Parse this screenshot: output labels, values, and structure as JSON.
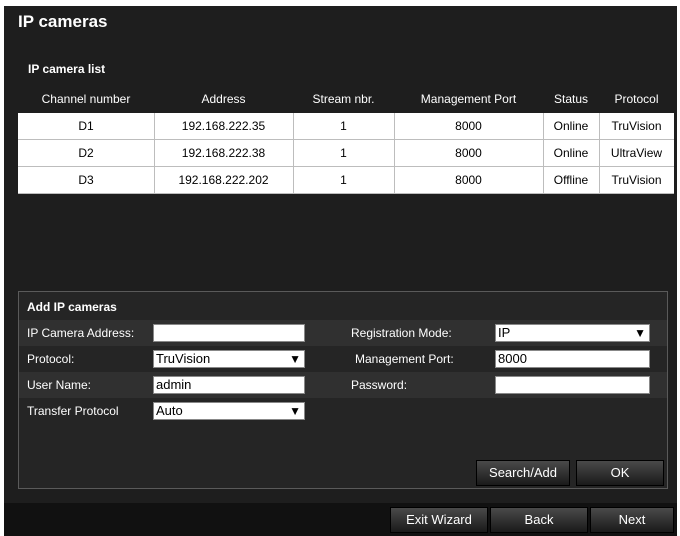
{
  "window": {
    "title": "IP cameras"
  },
  "list": {
    "label": "IP camera list",
    "headers": [
      "Channel number",
      "Address",
      "Stream nbr.",
      "Management Port",
      "Status",
      "Protocol"
    ],
    "rows": [
      [
        "D1",
        "192.168.222.35",
        "1",
        "8000",
        "Online",
        "TruVision"
      ],
      [
        "D2",
        "192.168.222.38",
        "1",
        "8000",
        "Online",
        "UltraView"
      ],
      [
        "D3",
        "192.168.222.202",
        "1",
        "8000",
        "Offline",
        "TruVision"
      ]
    ]
  },
  "add": {
    "title": "Add IP cameras",
    "ip_label": "IP Camera Address:",
    "ip_value": "",
    "reg_mode_label": "Registration Mode:",
    "reg_mode_value": "IP",
    "protocol_label": "Protocol:",
    "protocol_value": "TruVision",
    "mgmt_port_label": "Management Port:",
    "mgmt_port_value": "8000",
    "user_label": "User Name:",
    "user_value": "admin",
    "password_label": "Password:",
    "password_value": "",
    "transfer_label": "Transfer Protocol",
    "transfer_value": "Auto",
    "search_add": "Search/Add",
    "ok": "OK"
  },
  "footer": {
    "exit": "Exit Wizard",
    "back": "Back",
    "next": "Next"
  },
  "icons": {
    "chevron": "chevron-down-icon"
  }
}
